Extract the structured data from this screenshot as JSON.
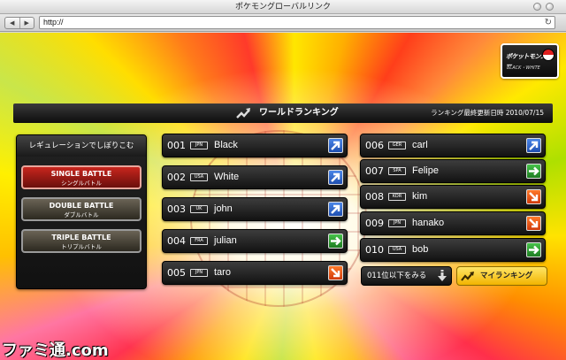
{
  "window": {
    "title": "ポケモングローバルリンク"
  },
  "toolbar": {
    "back_label": "◀",
    "forward_label": "▶",
    "url": "http://",
    "reload_label": "↻"
  },
  "logo": {
    "text": "ポケットモンスター",
    "subtext": "BLACK・WHITE"
  },
  "header": {
    "title": "ワールドランキング",
    "updated_label": "ランキング最終更新日時",
    "updated_date": "2010/07/15"
  },
  "regulation": {
    "title": "レギュレーションでしぼりこむ",
    "options": [
      {
        "en": "SINGLE BATTLE",
        "jp": "シングルバトル",
        "selected": true
      },
      {
        "en": "DOUBLE BATTLE",
        "jp": "ダブルバトル",
        "selected": false
      },
      {
        "en": "TRIPLE BATTLE",
        "jp": "トリプルバトル",
        "selected": false
      }
    ]
  },
  "rankings": [
    {
      "rank": "001",
      "country": "JPN",
      "name": "Black",
      "trend": "up"
    },
    {
      "rank": "002",
      "country": "USA",
      "name": "White",
      "trend": "up"
    },
    {
      "rank": "003",
      "country": "UK",
      "name": "john",
      "trend": "up"
    },
    {
      "rank": "004",
      "country": "FRA",
      "name": "julian",
      "trend": "flat"
    },
    {
      "rank": "005",
      "country": "JPN",
      "name": "taro",
      "trend": "down"
    },
    {
      "rank": "006",
      "country": "GER",
      "name": "carl",
      "trend": "up"
    },
    {
      "rank": "007",
      "country": "SPA",
      "name": "Felipe",
      "trend": "flat"
    },
    {
      "rank": "008",
      "country": "KOR",
      "name": "kim",
      "trend": "down"
    },
    {
      "rank": "009",
      "country": "JPN",
      "name": "hanako",
      "trend": "down"
    },
    {
      "rank": "010",
      "country": "USA",
      "name": "bob",
      "trend": "flat"
    }
  ],
  "more_button": {
    "label": "011位以下をみる"
  },
  "my_ranking_button": {
    "label": "マイランキング"
  },
  "watermark": {
    "text": "ファミ通.com"
  },
  "colors": {
    "trend_up": "#2f64cf",
    "trend_flat": "#2ea033",
    "trend_down": "#ef5a14",
    "selected_regulation": "#b3201a",
    "my_ranking": "#f5c400"
  },
  "icons": {
    "trend_up": "arrow-up-right-icon",
    "trend_flat": "arrow-right-icon",
    "trend_down": "arrow-down-right-icon",
    "header": "rising-trend-icon",
    "more": "arrow-down-icon",
    "my_ranking": "rising-trend-icon"
  }
}
